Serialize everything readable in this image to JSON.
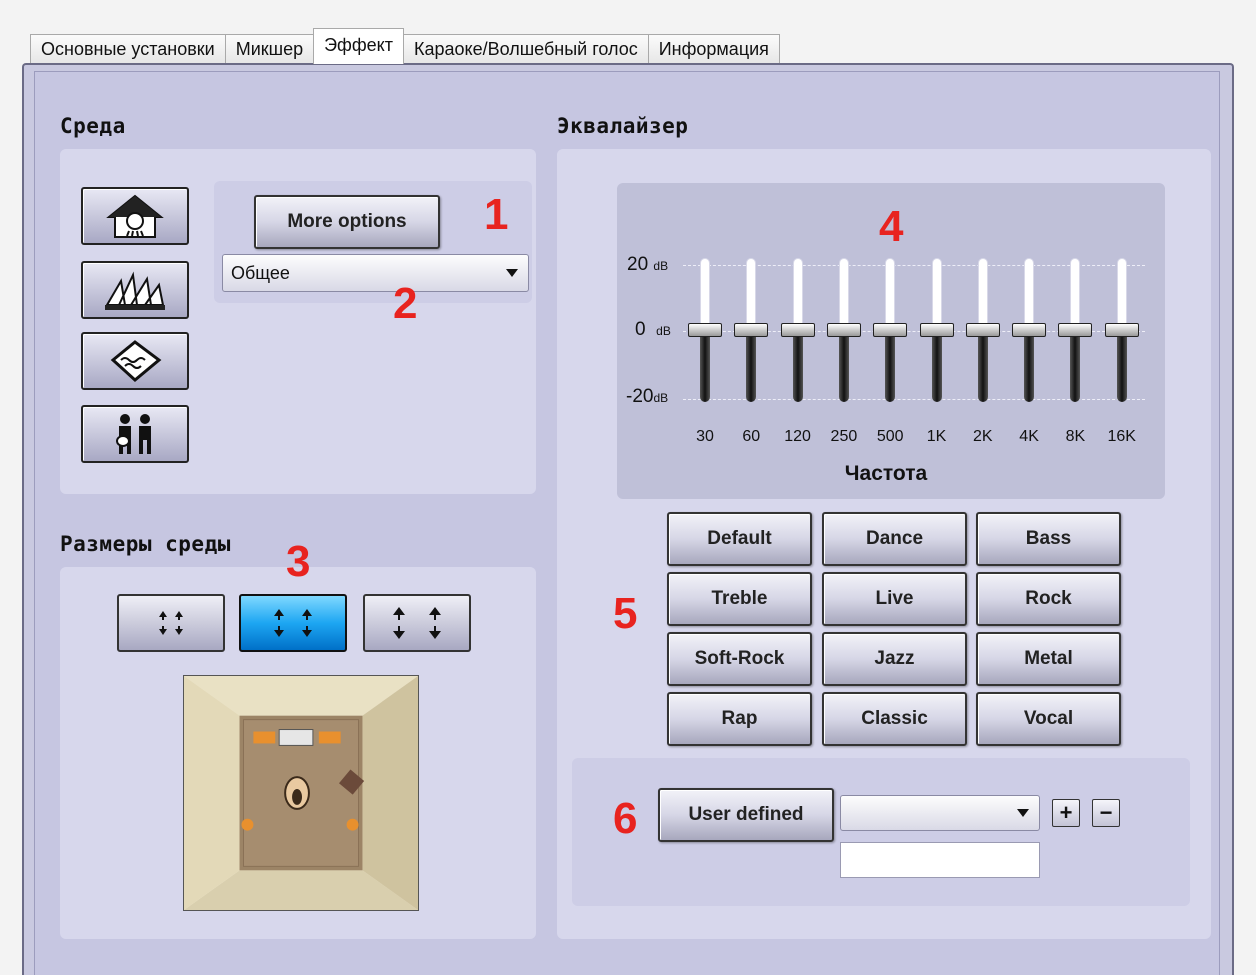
{
  "tabs": [
    {
      "label": "Основные установки"
    },
    {
      "label": "Микшер"
    },
    {
      "label": "Эффект"
    },
    {
      "label": "Караоке/Волшебный голос"
    },
    {
      "label": "Информация"
    }
  ],
  "active_tab": "Эффект",
  "environment": {
    "title": "Среда",
    "more_options_label": "More options",
    "preset_value": "Общее",
    "icons": [
      "shower-room-icon",
      "opera-house-icon",
      "carpet-room-icon",
      "musicians-icon"
    ]
  },
  "room_size": {
    "title": "Размеры среды",
    "selected_index": 1
  },
  "equalizer": {
    "title": "Эквалайзер",
    "db_top": "20",
    "db_mid": "0",
    "db_bottom": "-20",
    "db_unit": "dB",
    "frequency_label": "Частота",
    "bands": [
      {
        "freq": "30",
        "value": 0
      },
      {
        "freq": "60",
        "value": 0
      },
      {
        "freq": "120",
        "value": 0
      },
      {
        "freq": "250",
        "value": 0
      },
      {
        "freq": "500",
        "value": 0
      },
      {
        "freq": "1K",
        "value": 0
      },
      {
        "freq": "2K",
        "value": 0
      },
      {
        "freq": "4K",
        "value": 0
      },
      {
        "freq": "8K",
        "value": 0
      },
      {
        "freq": "16K",
        "value": 0
      }
    ],
    "presets": [
      "Default",
      "Dance",
      "Bass",
      "Treble",
      "Live",
      "Rock",
      "Soft-Rock",
      "Jazz",
      "Metal",
      "Rap",
      "Classic",
      "Vocal"
    ],
    "user_defined_label": "User defined",
    "user_select_value": "",
    "user_name_value": "",
    "add_label": "+",
    "remove_label": "−"
  },
  "markers": [
    "1",
    "2",
    "3",
    "4",
    "5",
    "6"
  ],
  "colors": {
    "marker": "#e8231f",
    "panel": "#c9c9e0",
    "selected_size": "#1da6f2"
  }
}
